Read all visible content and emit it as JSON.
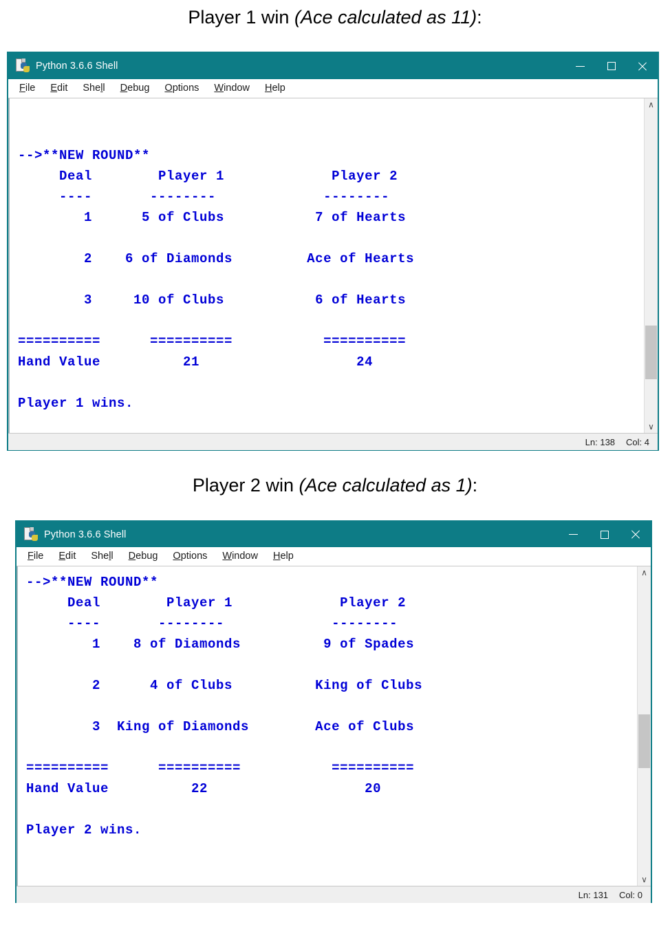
{
  "captions": {
    "first": {
      "plain": "Player 1 win ",
      "italic": "(Ace calculated as 11)",
      "suffix": ":"
    },
    "second": {
      "plain": "Player 2 win ",
      "italic": "(Ace calculated as 1)",
      "suffix": ":"
    }
  },
  "colors": {
    "titlebar": "#0d7c86",
    "console_text": "#0000d7",
    "window_border": "#0d7c86",
    "statusbar": "#efefef",
    "scroll_thumb": "#c5c5c5"
  },
  "window1": {
    "title": "Python 3.6.6 Shell",
    "icon": "python-file-icon",
    "controls": {
      "minimize": "minimize",
      "maximize": "maximize",
      "close": "close"
    },
    "menu": [
      {
        "accel": "F",
        "rest": "ile"
      },
      {
        "accel": "E",
        "rest": "dit"
      },
      {
        "pre": "She",
        "accel": "l",
        "rest": "l"
      },
      {
        "accel": "D",
        "rest": "ebug"
      },
      {
        "accel": "O",
        "rest": "ptions"
      },
      {
        "accel": "W",
        "rest": "indow"
      },
      {
        "accel": "H",
        "rest": "elp"
      }
    ],
    "console_lines": [
      "",
      "",
      "-->**NEW ROUND**",
      "     Deal        Player 1             Player 2",
      "     ----       --------             --------",
      "        1      5 of Clubs           7 of Hearts",
      "",
      "        2    6 of Diamonds         Ace of Hearts",
      "",
      "        3     10 of Clubs           6 of Hearts",
      "",
      "==========      ==========           ==========",
      "Hand Value          21                   24",
      "",
      "Player 1 wins."
    ],
    "status": {
      "line": "Ln: 138",
      "col": "Col: 4"
    },
    "scrollbar": {
      "up": "∧",
      "down": "∨"
    }
  },
  "window2": {
    "title": "Python 3.6.6 Shell",
    "icon": "python-file-icon",
    "controls": {
      "minimize": "minimize",
      "maximize": "maximize",
      "close": "close"
    },
    "menu": [
      {
        "accel": "F",
        "rest": "ile"
      },
      {
        "accel": "E",
        "rest": "dit"
      },
      {
        "pre": "She",
        "accel": "l",
        "rest": "l"
      },
      {
        "accel": "D",
        "rest": "ebug"
      },
      {
        "accel": "O",
        "rest": "ptions"
      },
      {
        "accel": "W",
        "rest": "indow"
      },
      {
        "accel": "H",
        "rest": "elp"
      }
    ],
    "console_lines": [
      "-->**NEW ROUND**",
      "     Deal        Player 1             Player 2",
      "     ----       --------             --------",
      "        1    8 of Diamonds          9 of Spades",
      "",
      "        2      4 of Clubs          King of Clubs",
      "",
      "        3  King of Diamonds        Ace of Clubs",
      "",
      "==========      ==========           ==========",
      "Hand Value          22                   20",
      "",
      "Player 2 wins."
    ],
    "status": {
      "line": "Ln: 131",
      "col": "Col: 0"
    },
    "scrollbar": {
      "up": "∧",
      "down": "∨"
    }
  },
  "game_data": {
    "round1": {
      "outcome": "Player 1 wins.",
      "ace_value": 11,
      "columns": [
        "Deal",
        "Player 1",
        "Player 2"
      ],
      "deals": [
        {
          "deal": 1,
          "player1": "5 of Clubs",
          "player2": "7 of Hearts"
        },
        {
          "deal": 2,
          "player1": "6 of Diamonds",
          "player2": "Ace of Hearts"
        },
        {
          "deal": 3,
          "player1": "10 of Clubs",
          "player2": "6 of Hearts"
        }
      ],
      "hand_value": {
        "player1": 21,
        "player2": 24
      }
    },
    "round2": {
      "outcome": "Player 2 wins.",
      "ace_value": 1,
      "columns": [
        "Deal",
        "Player 1",
        "Player 2"
      ],
      "deals": [
        {
          "deal": 1,
          "player1": "8 of Diamonds",
          "player2": "9 of Spades"
        },
        {
          "deal": 2,
          "player1": "4 of Clubs",
          "player2": "King of Clubs"
        },
        {
          "deal": 3,
          "player1": "King of Diamonds",
          "player2": "Ace of Clubs"
        }
      ],
      "hand_value": {
        "player1": 22,
        "player2": 20
      }
    }
  }
}
